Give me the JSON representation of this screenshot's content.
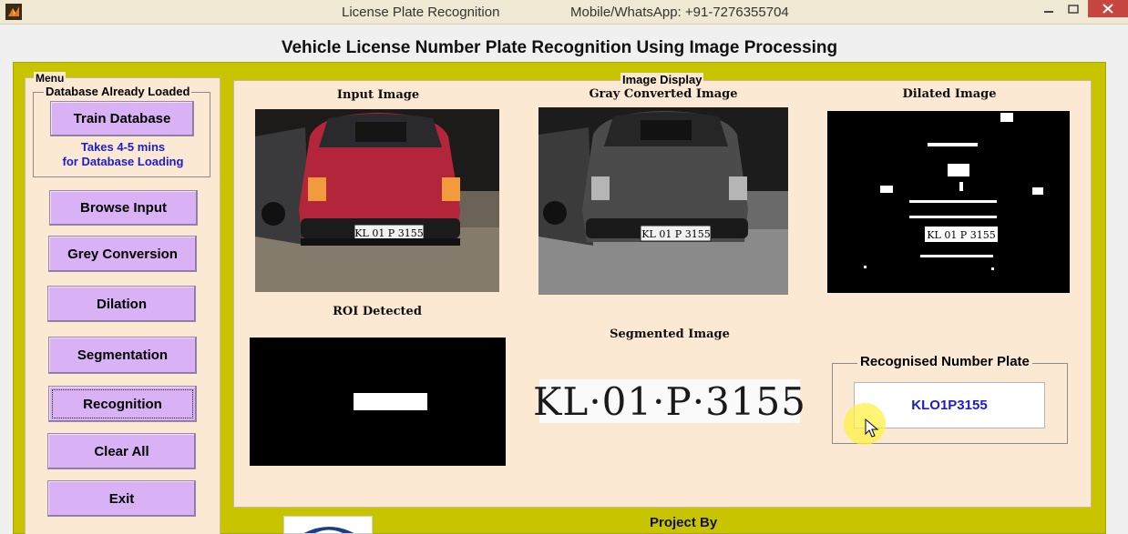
{
  "window": {
    "title": "License Plate Recognition",
    "contact": "Mobile/WhatsApp: +91-7276355704"
  },
  "heading": "Vehicle License Number Plate Recognition Using Image Processing",
  "menu": {
    "label": "Menu",
    "database_group_label": "Database Already Loaded",
    "train_button": "Train Database",
    "note_line1": "Takes 4-5 mins",
    "note_line2": "for Database Loading",
    "buttons": {
      "browse": "Browse Input",
      "grey": "Grey Conversion",
      "dilation": "Dilation",
      "segmentation": "Segmentation",
      "recognition": "Recognition",
      "clear": "Clear All",
      "exit": "Exit"
    }
  },
  "display": {
    "label": "Image Display",
    "input_caption": "Input Image",
    "gray_caption": "Gray Converted Image",
    "dilated_caption": "Dilated Image",
    "roi_caption": "ROI Detected",
    "segmented_caption": "Segmented Image",
    "plate_text": "KL 01 P 3155",
    "segmented_text": "KL·01·P·3155"
  },
  "recognised": {
    "label": "Recognised Number Plate",
    "value": "KLO1P3155"
  },
  "footer": {
    "project_by": "Project By"
  },
  "colors": {
    "panel_bg": "#fbe9d4",
    "outer_bg": "#c8c400",
    "button_bg": "#d8b2f4",
    "note_blue": "#1b1bd0",
    "car_red": "#b3253a"
  }
}
